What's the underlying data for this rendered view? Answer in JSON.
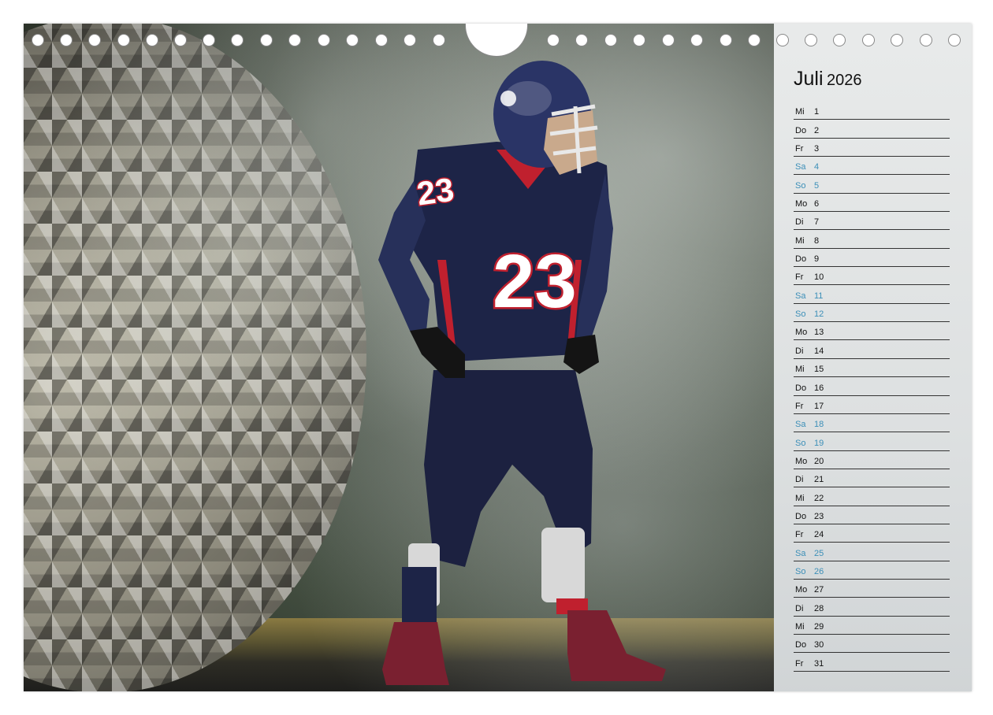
{
  "calendar": {
    "month": "Juli",
    "year": "2026",
    "days": [
      {
        "wd": "Mi",
        "d": "1",
        "weekend": false
      },
      {
        "wd": "Do",
        "d": "2",
        "weekend": false
      },
      {
        "wd": "Fr",
        "d": "3",
        "weekend": false
      },
      {
        "wd": "Sa",
        "d": "4",
        "weekend": true
      },
      {
        "wd": "So",
        "d": "5",
        "weekend": true
      },
      {
        "wd": "Mo",
        "d": "6",
        "weekend": false
      },
      {
        "wd": "Di",
        "d": "7",
        "weekend": false
      },
      {
        "wd": "Mi",
        "d": "8",
        "weekend": false
      },
      {
        "wd": "Do",
        "d": "9",
        "weekend": false
      },
      {
        "wd": "Fr",
        "d": "10",
        "weekend": false
      },
      {
        "wd": "Sa",
        "d": "11",
        "weekend": true
      },
      {
        "wd": "So",
        "d": "12",
        "weekend": true
      },
      {
        "wd": "Mo",
        "d": "13",
        "weekend": false
      },
      {
        "wd": "Di",
        "d": "14",
        "weekend": false
      },
      {
        "wd": "Mi",
        "d": "15",
        "weekend": false
      },
      {
        "wd": "Do",
        "d": "16",
        "weekend": false
      },
      {
        "wd": "Fr",
        "d": "17",
        "weekend": false
      },
      {
        "wd": "Sa",
        "d": "18",
        "weekend": true
      },
      {
        "wd": "So",
        "d": "19",
        "weekend": true
      },
      {
        "wd": "Mo",
        "d": "20",
        "weekend": false
      },
      {
        "wd": "Di",
        "d": "21",
        "weekend": false
      },
      {
        "wd": "Mi",
        "d": "22",
        "weekend": false
      },
      {
        "wd": "Do",
        "d": "23",
        "weekend": false
      },
      {
        "wd": "Fr",
        "d": "24",
        "weekend": false
      },
      {
        "wd": "Sa",
        "d": "25",
        "weekend": true
      },
      {
        "wd": "So",
        "d": "26",
        "weekend": true
      },
      {
        "wd": "Mo",
        "d": "27",
        "weekend": false
      },
      {
        "wd": "Di",
        "d": "28",
        "weekend": false
      },
      {
        "wd": "Mi",
        "d": "29",
        "weekend": false
      },
      {
        "wd": "Do",
        "d": "30",
        "weekend": false
      },
      {
        "wd": "Fr",
        "d": "31",
        "weekend": false
      }
    ]
  },
  "photo": {
    "jersey_number": "23",
    "subject": "football-player-icon"
  },
  "colors": {
    "weekend": "#3c8fb8",
    "jersey": "#1d2447",
    "jersey_accent": "#c0202e"
  }
}
